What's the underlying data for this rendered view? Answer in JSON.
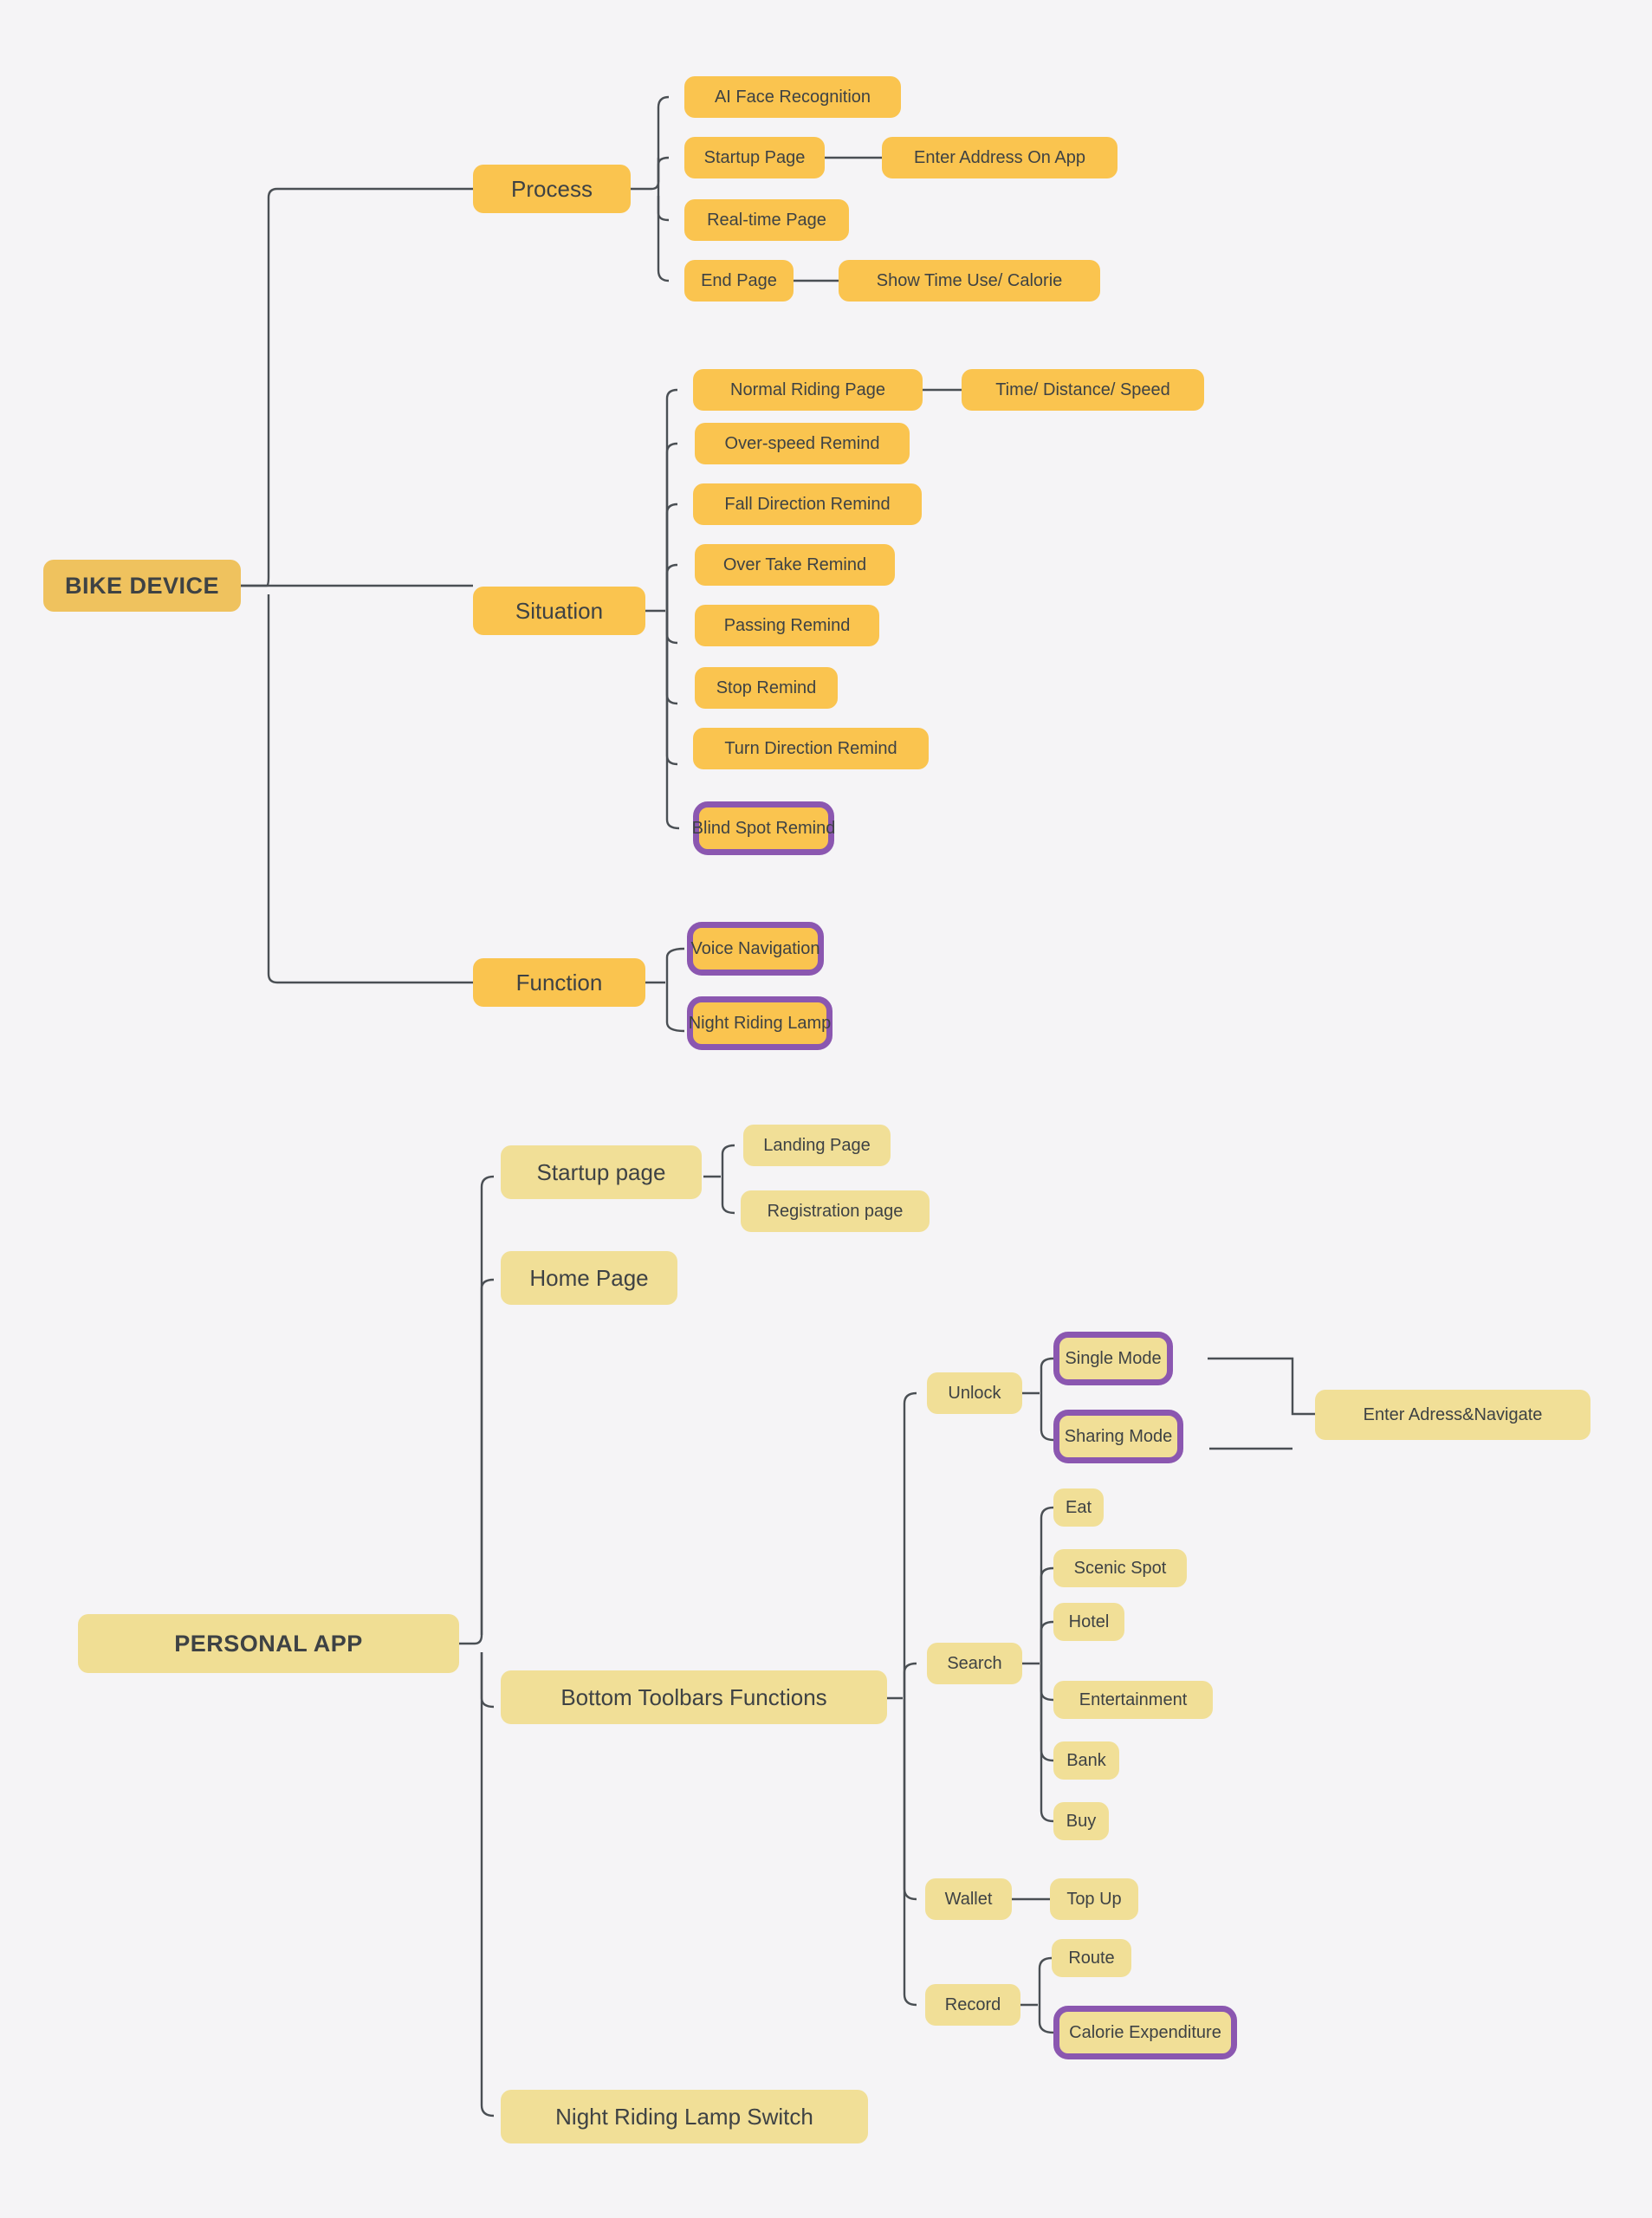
{
  "diagram": {
    "title_root_1": "BIKE DEVICE",
    "title_root_2": "PERSONAL APP",
    "background_color": "#F5F4F6",
    "colors": {
      "bike_node": "#FAC44F",
      "bike_root": "#EFC25E",
      "app_node": "#F1DF97",
      "app_root": "#F0DE94",
      "highlight_border": "#8B57B0",
      "connector": "#4A4F54",
      "text": "#3E4244"
    }
  },
  "bike_device": {
    "root": "BIKE DEVICE",
    "branches": [
      {
        "label": "Process",
        "children": [
          {
            "label": "AI Face Recognition",
            "children": []
          },
          {
            "label": "Startup Page",
            "children": [
              {
                "label": "Enter Address On App"
              }
            ]
          },
          {
            "label": "Real-time Page",
            "children": []
          },
          {
            "label": "End Page",
            "children": [
              {
                "label": "Show Time Use/ Calorie"
              }
            ]
          }
        ]
      },
      {
        "label": "Situation",
        "children": [
          {
            "label": "Normal Riding Page",
            "children": [
              {
                "label": "Time/ Distance/ Speed"
              }
            ]
          },
          {
            "label": "Over-speed Remind",
            "children": []
          },
          {
            "label": "Fall Direction Remind",
            "children": []
          },
          {
            "label": "Over Take Remind",
            "children": []
          },
          {
            "label": "Passing Remind",
            "children": []
          },
          {
            "label": "Stop Remind",
            "children": []
          },
          {
            "label": "Turn Direction Remind",
            "children": []
          },
          {
            "label": "Blind Spot Remind",
            "highlighted": true,
            "children": []
          }
        ]
      },
      {
        "label": "Function",
        "children": [
          {
            "label": "Voice Navigation",
            "highlighted": true,
            "children": []
          },
          {
            "label": "Night Riding Lamp",
            "highlighted": true,
            "children": []
          }
        ]
      }
    ]
  },
  "personal_app": {
    "root": "PERSONAL APP",
    "branches": [
      {
        "label": "Startup page",
        "children": [
          {
            "label": "Landing Page"
          },
          {
            "label": "Registration page"
          }
        ]
      },
      {
        "label": "Home Page",
        "children": []
      },
      {
        "label": "Bottom Toolbars Functions",
        "children": [
          {
            "label": "Unlock",
            "children": [
              {
                "label": "Single Mode",
                "highlighted": true
              },
              {
                "label": "Sharing Mode",
                "highlighted": true
              }
            ],
            "merged_child": "Enter Adress&Navigate"
          },
          {
            "label": "Search",
            "children": [
              {
                "label": "Eat"
              },
              {
                "label": "Scenic Spot"
              },
              {
                "label": "Hotel"
              },
              {
                "label": "Entertainment"
              },
              {
                "label": "Bank"
              },
              {
                "label": "Buy"
              }
            ]
          },
          {
            "label": "Wallet",
            "children": [
              {
                "label": "Top Up"
              }
            ]
          },
          {
            "label": "Record",
            "children": [
              {
                "label": "Route"
              },
              {
                "label": "Calorie Expenditure",
                "highlighted": true
              }
            ]
          }
        ]
      },
      {
        "label": "Night Riding Lamp Switch",
        "children": []
      }
    ]
  }
}
